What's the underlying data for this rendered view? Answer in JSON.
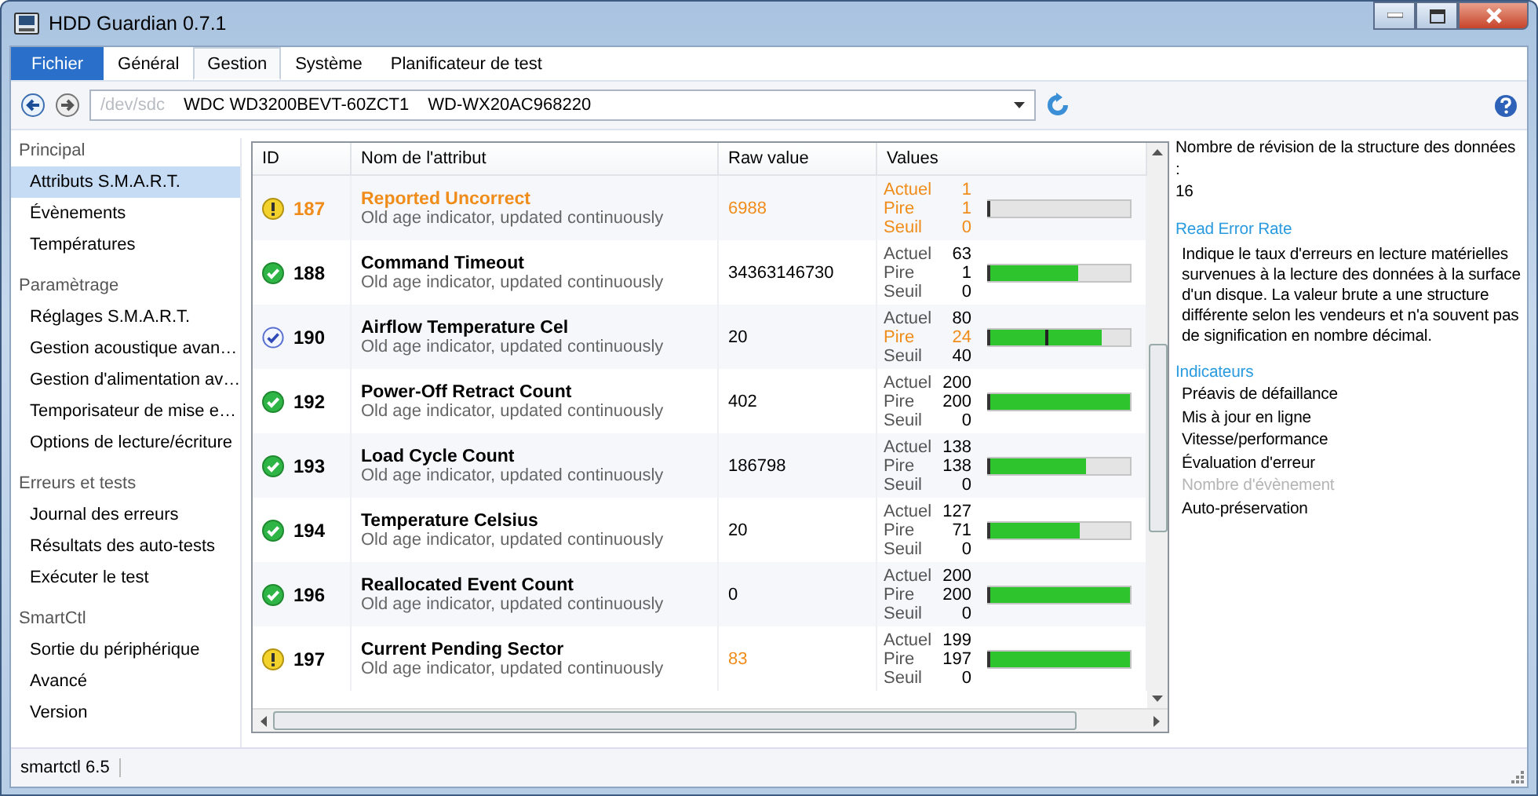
{
  "window": {
    "title": "HDD Guardian 0.7.1"
  },
  "tabs": [
    {
      "label": "Fichier",
      "kind": "file",
      "selected": false
    },
    {
      "label": "Général",
      "kind": "tab",
      "selected": false
    },
    {
      "label": "Gestion",
      "kind": "tab",
      "selected": true
    },
    {
      "label": "Système",
      "kind": "tab",
      "selected": false
    },
    {
      "label": "Planificateur de test",
      "kind": "tab",
      "selected": false
    }
  ],
  "device": {
    "path": "/dev/sdc",
    "model": "WDC WD3200BEVT-60ZCT1",
    "serial": "WD-WX20AC968220"
  },
  "sidebar": {
    "sections": [
      {
        "title": "Principal",
        "items": [
          {
            "label": "Attributs S.M.A.R.T.",
            "selected": true
          },
          {
            "label": "Évènements",
            "selected": false
          },
          {
            "label": "Températures",
            "selected": false
          }
        ]
      },
      {
        "title": "Paramètrage",
        "items": [
          {
            "label": "Réglages S.M.A.R.T.",
            "selected": false
          },
          {
            "label": "Gestion acoustique avan…",
            "selected": false
          },
          {
            "label": "Gestion d'alimentation av…",
            "selected": false
          },
          {
            "label": "Temporisateur de mise e…",
            "selected": false
          },
          {
            "label": "Options de lecture/écriture",
            "selected": false
          }
        ]
      },
      {
        "title": "Erreurs et tests",
        "items": [
          {
            "label": "Journal des erreurs",
            "selected": false
          },
          {
            "label": "Résultats des auto-tests",
            "selected": false
          },
          {
            "label": "Exécuter le test",
            "selected": false
          }
        ]
      },
      {
        "title": "SmartCtl",
        "items": [
          {
            "label": "Sortie du périphérique",
            "selected": false
          },
          {
            "label": "Avancé",
            "selected": false
          },
          {
            "label": "Version",
            "selected": false
          }
        ]
      }
    ]
  },
  "table": {
    "columns": [
      "ID",
      "Nom de l'attribut",
      "Raw value",
      "Values"
    ],
    "rows": [
      {
        "kind": "warning",
        "highlighted": true,
        "id": "187",
        "name": "Reported Uncorrect",
        "description": "Old age indicator, updated continuously",
        "raw": "6988",
        "raw_warn": true,
        "values": [
          {
            "label": "Actuel",
            "value": "1",
            "warn": true
          },
          {
            "label": "Pire",
            "value": "1",
            "warn": true
          },
          {
            "label": "Seuil",
            "value": "0",
            "warn": true
          }
        ],
        "bar": {
          "level": 0
        }
      },
      {
        "kind": "ok",
        "highlighted": false,
        "id": "188",
        "name": "Command Timeout",
        "description": "Old age indicator, updated continuously",
        "raw": "34363146730",
        "raw_warn": false,
        "values": [
          {
            "label": "Actuel",
            "value": "63",
            "warn": false
          },
          {
            "label": "Pire",
            "value": "1",
            "warn": false
          },
          {
            "label": "Seuil",
            "value": "0",
            "warn": false
          }
        ],
        "bar": {
          "level": 0.63
        }
      },
      {
        "kind": "info",
        "highlighted": false,
        "id": "190",
        "name": "Airflow Temperature Cel",
        "description": "Old age indicator, updated continuously",
        "raw": "20",
        "raw_warn": false,
        "values": [
          {
            "label": "Actuel",
            "value": "80",
            "warn": false
          },
          {
            "label": "Pire",
            "value": "24",
            "warn": true
          },
          {
            "label": "Seuil",
            "value": "40",
            "warn": false
          }
        ],
        "bar": {
          "level": 0.8
        },
        "marker": {
          "level": 0.41
        }
      },
      {
        "kind": "ok",
        "highlighted": false,
        "id": "192",
        "name": "Power-Off Retract Count",
        "description": "Old age indicator, updated continuously",
        "raw": "402",
        "raw_warn": false,
        "values": [
          {
            "label": "Actuel",
            "value": "200",
            "warn": false
          },
          {
            "label": "Pire",
            "value": "200",
            "warn": false
          },
          {
            "label": "Seuil",
            "value": "0",
            "warn": false
          }
        ],
        "bar": {
          "level": 1
        }
      },
      {
        "kind": "ok",
        "highlighted": false,
        "id": "193",
        "name": "Load Cycle Count",
        "description": "Old age indicator, updated continuously",
        "raw": "186798",
        "raw_warn": false,
        "values": [
          {
            "label": "Actuel",
            "value": "138",
            "warn": false
          },
          {
            "label": "Pire",
            "value": "138",
            "warn": false
          },
          {
            "label": "Seuil",
            "value": "0",
            "warn": false
          }
        ],
        "bar": {
          "level": 0.69
        }
      },
      {
        "kind": "ok",
        "highlighted": false,
        "id": "194",
        "name": "Temperature Celsius",
        "description": "Old age indicator, updated continuously",
        "raw": "20",
        "raw_warn": false,
        "values": [
          {
            "label": "Actuel",
            "value": "127",
            "warn": false
          },
          {
            "label": "Pire",
            "value": "71",
            "warn": false
          },
          {
            "label": "Seuil",
            "value": "0",
            "warn": false
          }
        ],
        "bar": {
          "level": 0.64
        }
      },
      {
        "kind": "ok",
        "highlighted": false,
        "id": "196",
        "name": "Reallocated Event Count",
        "description": "Old age indicator, updated continuously",
        "raw": "0",
        "raw_warn": false,
        "values": [
          {
            "label": "Actuel",
            "value": "200",
            "warn": false
          },
          {
            "label": "Pire",
            "value": "200",
            "warn": false
          },
          {
            "label": "Seuil",
            "value": "0",
            "warn": false
          }
        ],
        "bar": {
          "level": 1
        }
      },
      {
        "kind": "warning",
        "highlighted": false,
        "id": "197",
        "name": "Current Pending Sector",
        "description": "Old age indicator, updated continuously",
        "raw": "83",
        "raw_warn": true,
        "values": [
          {
            "label": "Actuel",
            "value": "199",
            "warn": false
          },
          {
            "label": "Pire",
            "value": "197",
            "warn": false
          },
          {
            "label": "Seuil",
            "value": "0",
            "warn": false
          }
        ],
        "bar": {
          "level": 1
        }
      }
    ]
  },
  "details": {
    "revision_label": "Nombre de révision de la structure des données :",
    "revision_value": "16",
    "attribute_title": "Read Error Rate",
    "attribute_text": "Indique le taux d'erreurs en lecture matérielles survenues à la lecture des données à la surface d'un disque. La valeur brute a une structure différente selon les vendeurs et n'a souvent pas de signification en nombre décimal.",
    "indicators_title": "Indicateurs",
    "indicators": [
      {
        "label": "Préavis de défaillance",
        "disabled": false
      },
      {
        "label": "Mis à jour en ligne",
        "disabled": false
      },
      {
        "label": "Vitesse/performance",
        "disabled": false
      },
      {
        "label": "Évaluation d'erreur",
        "disabled": false
      },
      {
        "label": "Nombre d'évènement",
        "disabled": true
      },
      {
        "label": "Auto-préservation",
        "disabled": false
      }
    ]
  },
  "status_bar": {
    "text": "smartctl 6.5"
  }
}
